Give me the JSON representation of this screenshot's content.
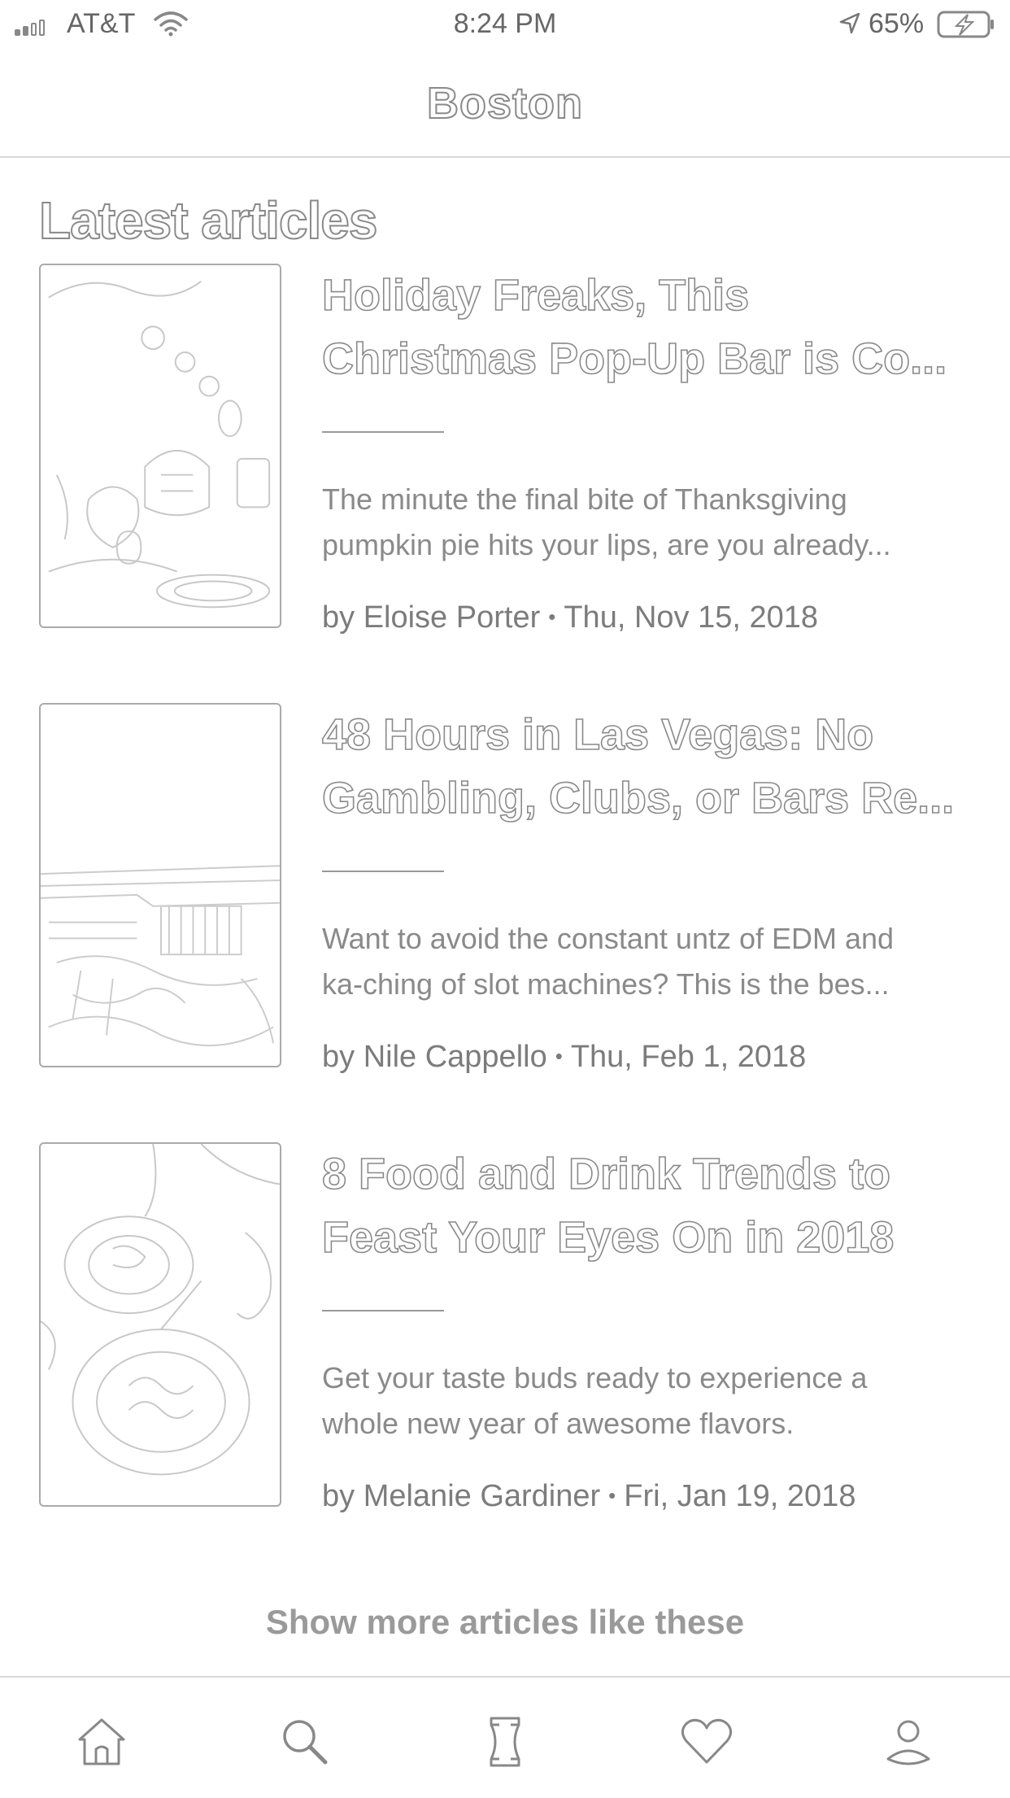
{
  "status_bar": {
    "carrier": "AT&T",
    "time": "8:24 PM",
    "battery": "65%"
  },
  "header": {
    "title": "Boston"
  },
  "section": {
    "title": "Latest articles"
  },
  "articles": [
    {
      "title_lines": [
        "Holiday Freaks, This",
        "Christmas Pop-Up Bar is Co..."
      ],
      "desc_lines": [
        "The minute the final bite of Thanksgiving",
        "pumpkin pie hits your lips, are you already..."
      ],
      "author": "by Eloise Porter",
      "date": "Thu, Nov 15, 2018"
    },
    {
      "title_lines": [
        "48 Hours in Las Vegas: No",
        "Gambling, Clubs, or Bars Re..."
      ],
      "desc_lines": [
        "Want to avoid the constant untz of EDM and",
        "ka-ching of slot machines? This is the bes..."
      ],
      "author": "by Nile Cappello",
      "date": "Thu, Feb 1, 2018"
    },
    {
      "title_lines": [
        "8 Food and Drink Trends to",
        "Feast Your Eyes On in 2018"
      ],
      "desc_lines": [
        "Get your taste buds ready to experience a",
        "whole new year of awesome flavors."
      ],
      "author": "by Melanie Gardiner",
      "date": "Fri, Jan 19, 2018"
    }
  ],
  "show_more": "Show more articles like these",
  "tab_bar": {
    "tabs": [
      "home-icon",
      "search-icon",
      "trips-icon",
      "heart-icon",
      "profile-icon"
    ]
  },
  "meta_separator": "•"
}
